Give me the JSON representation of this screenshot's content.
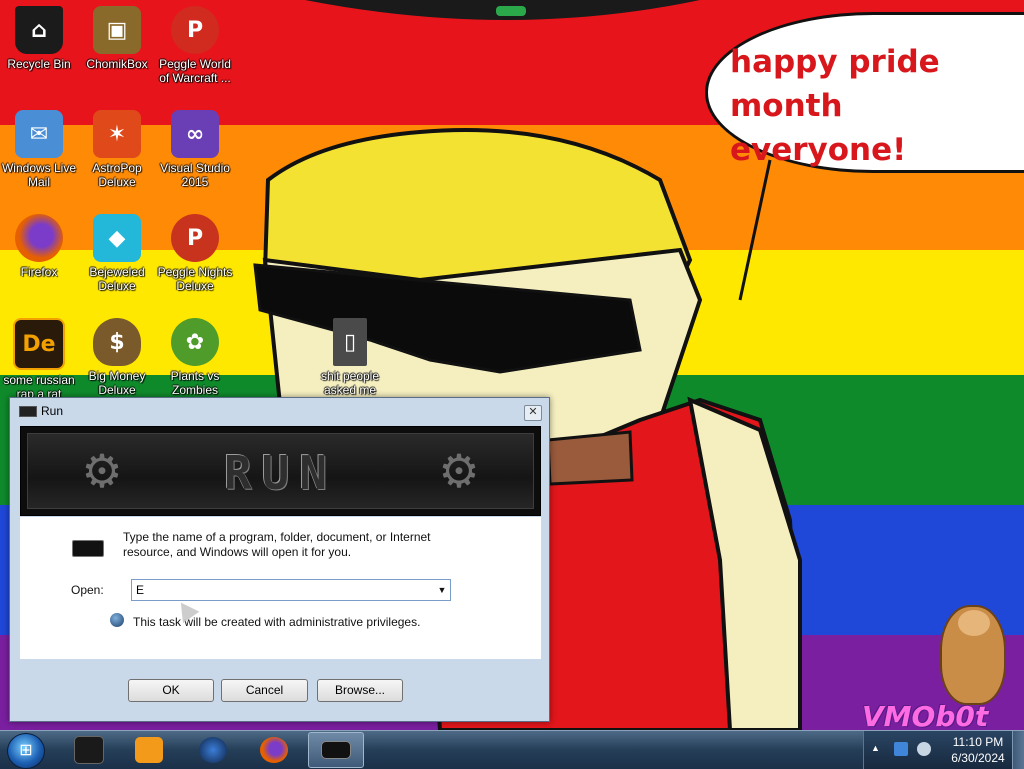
{
  "wallpaper": {
    "speech_bubble": [
      "happy pride month",
      "everyone!"
    ],
    "watermark": "VMOb0t"
  },
  "desktop": {
    "icons": [
      {
        "label": "Recycle Bin",
        "icon": "recycle-bin-icon",
        "color": "#1b1b1b"
      },
      {
        "label": "ChomikBox",
        "icon": "chomikbox-icon",
        "color": "#8a6a2a"
      },
      {
        "label": "Peggle World of Warcraft ...",
        "icon": "peggle-wow-icon",
        "color": "#d12a1e"
      },
      {
        "label": "Windows Live Mail",
        "icon": "windows-live-mail-icon",
        "color": "#4a8ed6"
      },
      {
        "label": "AstroPop Deluxe",
        "icon": "astropop-icon",
        "color": "#e04a1a"
      },
      {
        "label": "Visual Studio 2015",
        "icon": "visual-studio-icon",
        "color": "#6a3fb5"
      },
      {
        "label": "Firefox",
        "icon": "firefox-icon",
        "color": "#e66000"
      },
      {
        "label": "Bejeweled Deluxe",
        "icon": "bejeweled-icon",
        "color": "#23b7d9"
      },
      {
        "label": "Peggle Nights Deluxe",
        "icon": "peggle-nights-icon",
        "color": "#c8331d"
      },
      {
        "label": "some russian rap a rat",
        "icon": "de-icon",
        "color": "#2a1a0a"
      },
      {
        "label": "Big Money Deluxe",
        "icon": "money-bag-icon",
        "color": "#7a5a2a"
      },
      {
        "label": "Plants vs Zombies",
        "icon": "plants-vs-zombies-icon",
        "color": "#4f9c2a"
      },
      {
        "label": "shit people asked me",
        "icon": "folder-icon",
        "color": "#4a4a4a"
      }
    ]
  },
  "run_dialog": {
    "title": "Run",
    "banner_text": "RUN",
    "description": "Type the name of a program, folder, document, or Internet resource, and Windows will open it for you.",
    "open_label": "Open:",
    "open_value": "E",
    "admin_note": "This task will be created with administrative privileges.",
    "buttons": {
      "ok": "OK",
      "cancel": "Cancel",
      "browse": "Browse..."
    },
    "close_glyph": "✕"
  },
  "taskbar": {
    "start_glyph": "⊞",
    "pinned": [
      {
        "icon": "black-box-icon",
        "color": "#1a1a1a",
        "active": false
      },
      {
        "icon": "media-player-icon",
        "color": "#f39a1a",
        "active": false
      },
      {
        "icon": "globe-icon",
        "color": "#1f4b8a",
        "active": false
      },
      {
        "icon": "firefox-icon",
        "color": "#e66000",
        "active": false
      },
      {
        "icon": "run-icon",
        "color": "#111111",
        "active": true
      }
    ],
    "tray": {
      "overflow_glyph": "▲",
      "time": "11:10 PM",
      "date": "6/30/2024"
    }
  }
}
